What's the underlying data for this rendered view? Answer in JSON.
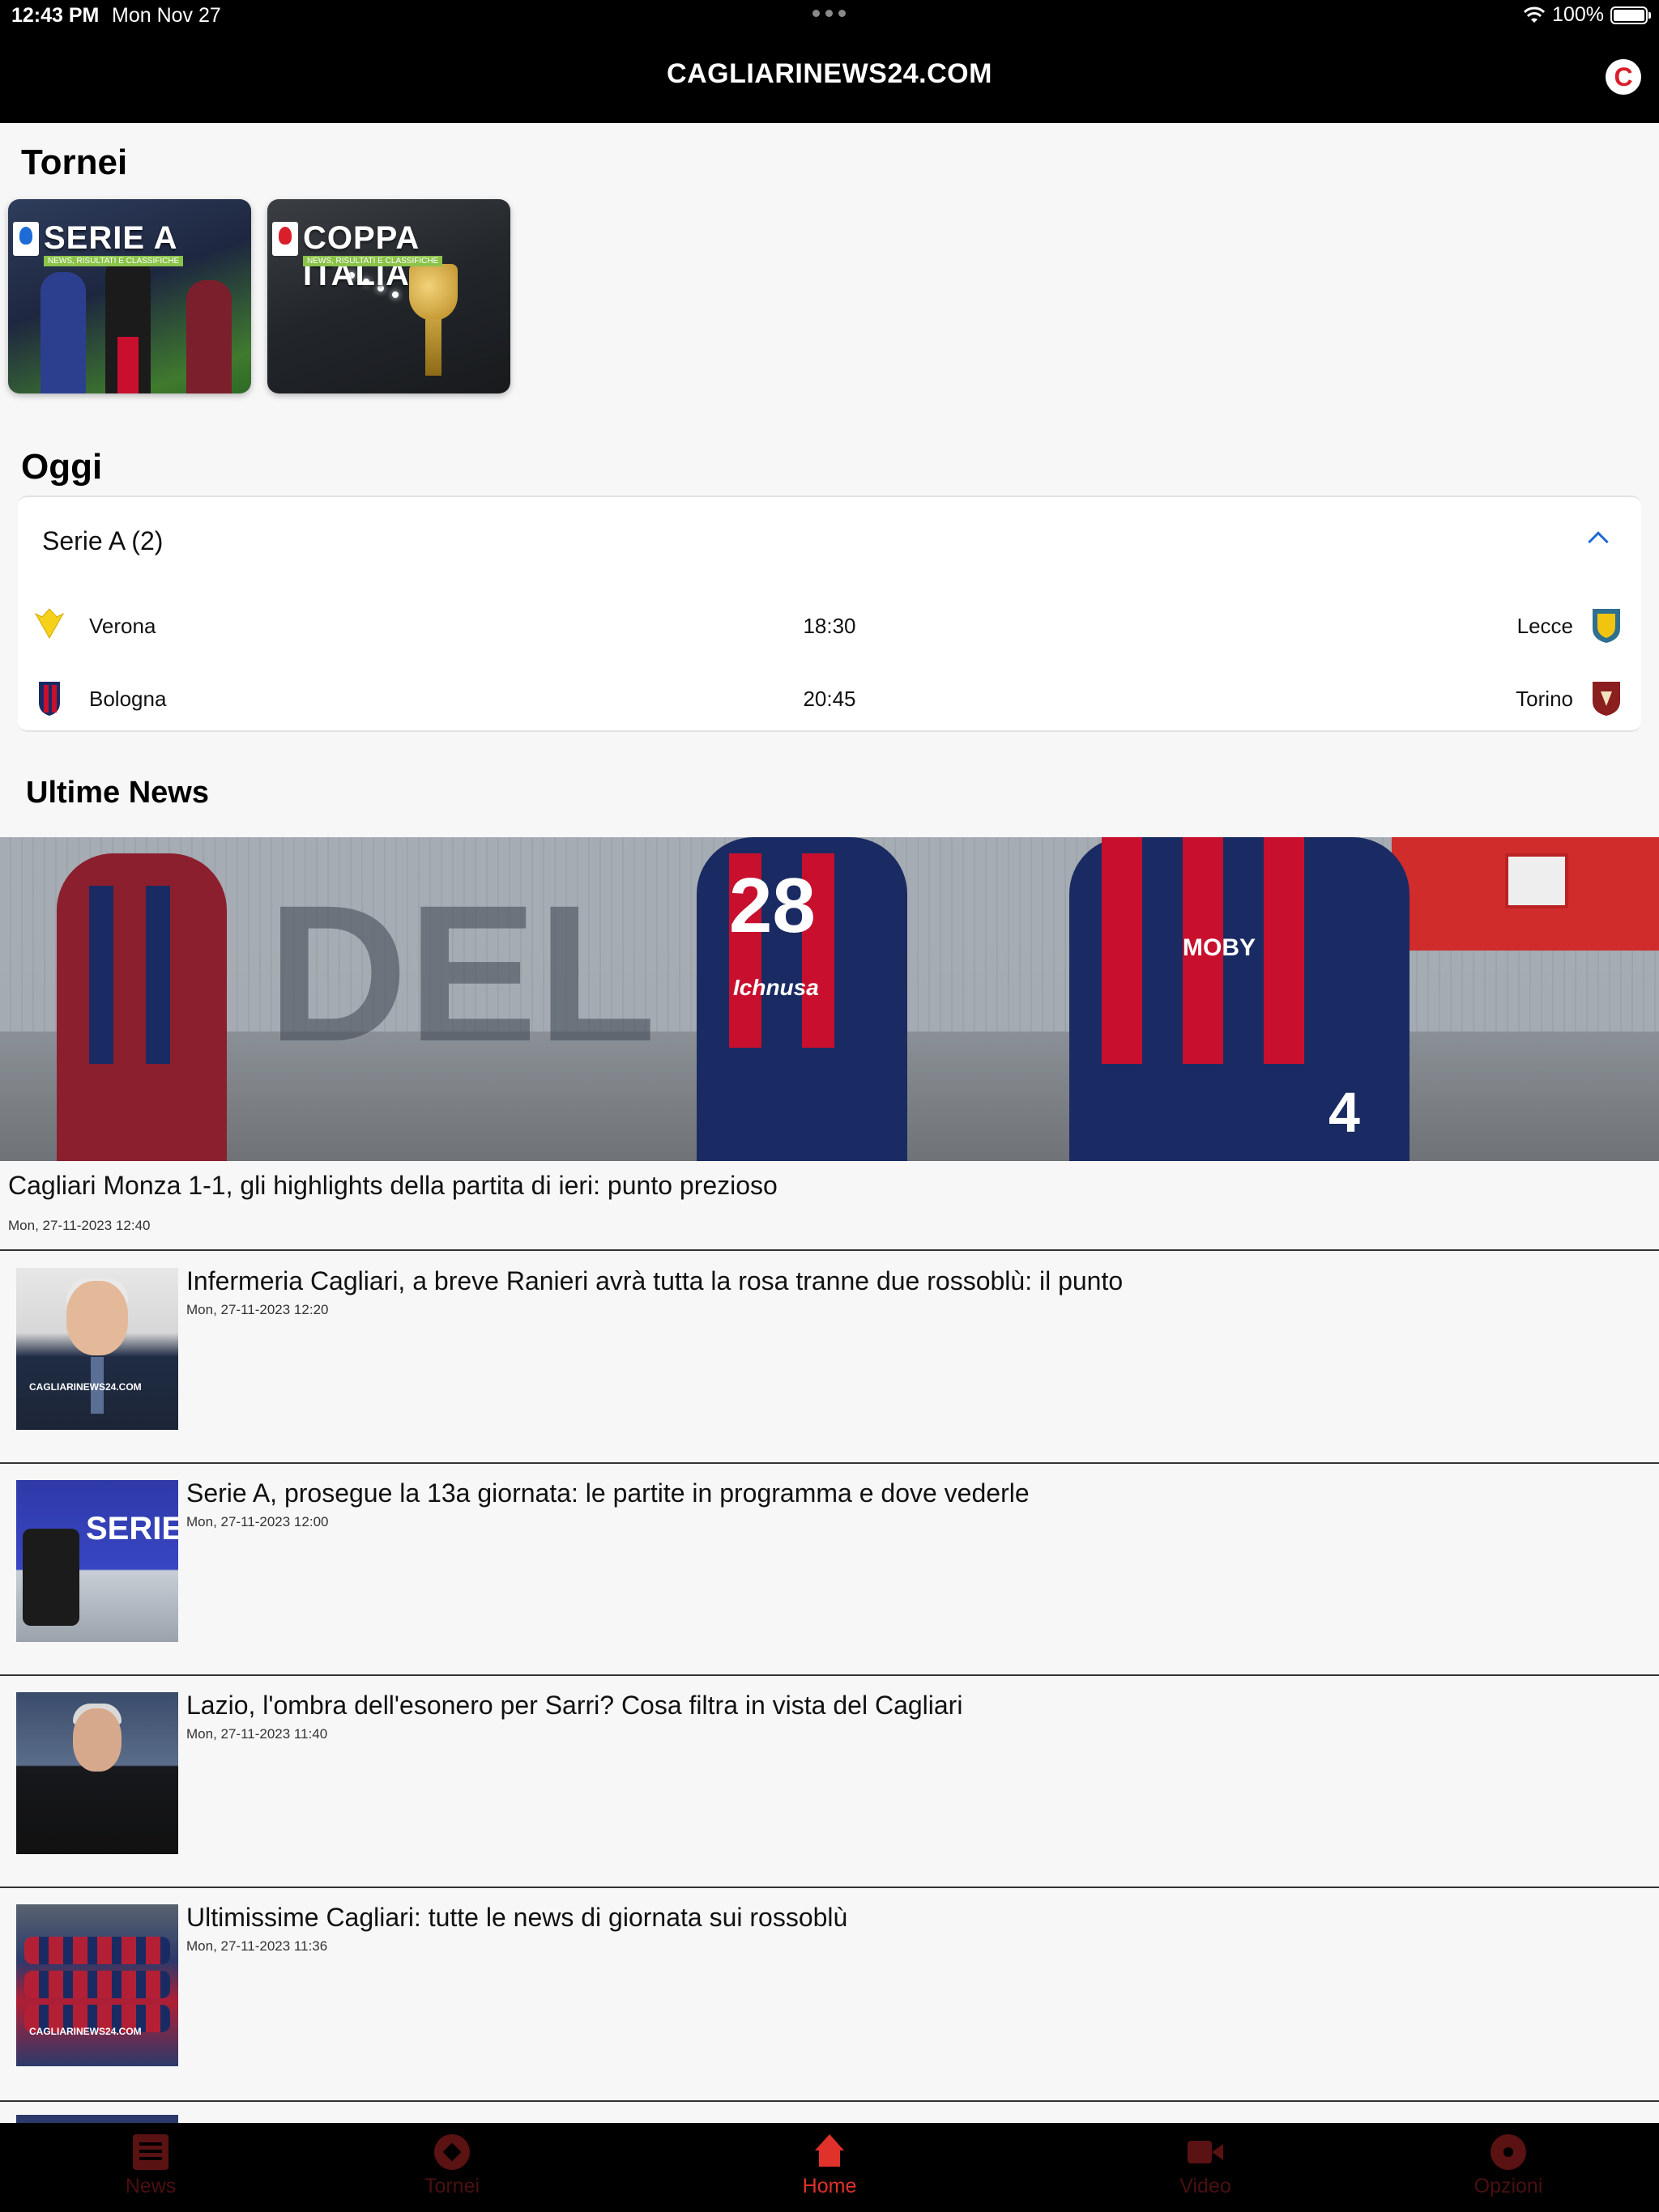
{
  "status_bar": {
    "time": "12:43 PM",
    "date": "Mon Nov 27",
    "battery": "100%"
  },
  "header": {
    "title": "CAGLIARINEWS24.COM",
    "badge_letter": "C"
  },
  "tournaments": {
    "title": "Tornei",
    "items": [
      {
        "label": "SERIE A",
        "sub": "NEWS, RISULTATI E CLASSIFICHE"
      },
      {
        "label": "COPPA ITALIA",
        "sub": "NEWS, RISULTATI E CLASSIFICHE"
      }
    ]
  },
  "today": {
    "title": "Oggi",
    "league": "Serie A (2)",
    "matches": [
      {
        "home": "Verona",
        "time": "18:30",
        "away": "Lecce"
      },
      {
        "home": "Bologna",
        "time": "20:45",
        "away": "Torino"
      }
    ]
  },
  "news": {
    "title": "Ultime News",
    "hero": {
      "title": "Cagliari Monza 1-1, gli highlights della partita di ieri: punto prezioso",
      "date": "Mon, 27-11-2023 12:40",
      "image_text": [
        "DEL",
        "28",
        "4",
        "MOBY",
        "Ichnusa"
      ]
    },
    "items": [
      {
        "title": "Infermeria Cagliari, a breve Ranieri avrà tutta la rosa tranne due rossoblù: il punto",
        "date": "Mon, 27-11-2023 12:20",
        "watermark": "CAGLIARINEWS24.COM"
      },
      {
        "title": "Serie A, prosegue la 13a giornata: le partite in programma e dove vederle",
        "date": "Mon, 27-11-2023 12:00",
        "thumb_text": "SERIE"
      },
      {
        "title": "Lazio, l'ombra dell'esonero per Sarri? Cosa filtra in vista del Cagliari",
        "date": "Mon, 27-11-2023 11:40"
      },
      {
        "title": "Ultimissime Cagliari: tutte le news di giornata sui rossoblù",
        "date": "Mon, 27-11-2023 11:36",
        "watermark": "CAGLIARINEWS24.COM"
      }
    ]
  },
  "tabbar": {
    "items": [
      {
        "label": "News",
        "icon": "newspaper-icon"
      },
      {
        "label": "Tornei",
        "icon": "football-icon"
      },
      {
        "label": "Home",
        "icon": "home-icon"
      },
      {
        "label": "Video",
        "icon": "video-camera-icon"
      },
      {
        "label": "Opzioni",
        "icon": "gear-icon"
      }
    ],
    "active": "Home"
  },
  "colors": {
    "header_bg": "#000000",
    "accent": "#e0312b",
    "inactive_tab": "#4a1010",
    "chevron": "#1e6bd6"
  }
}
